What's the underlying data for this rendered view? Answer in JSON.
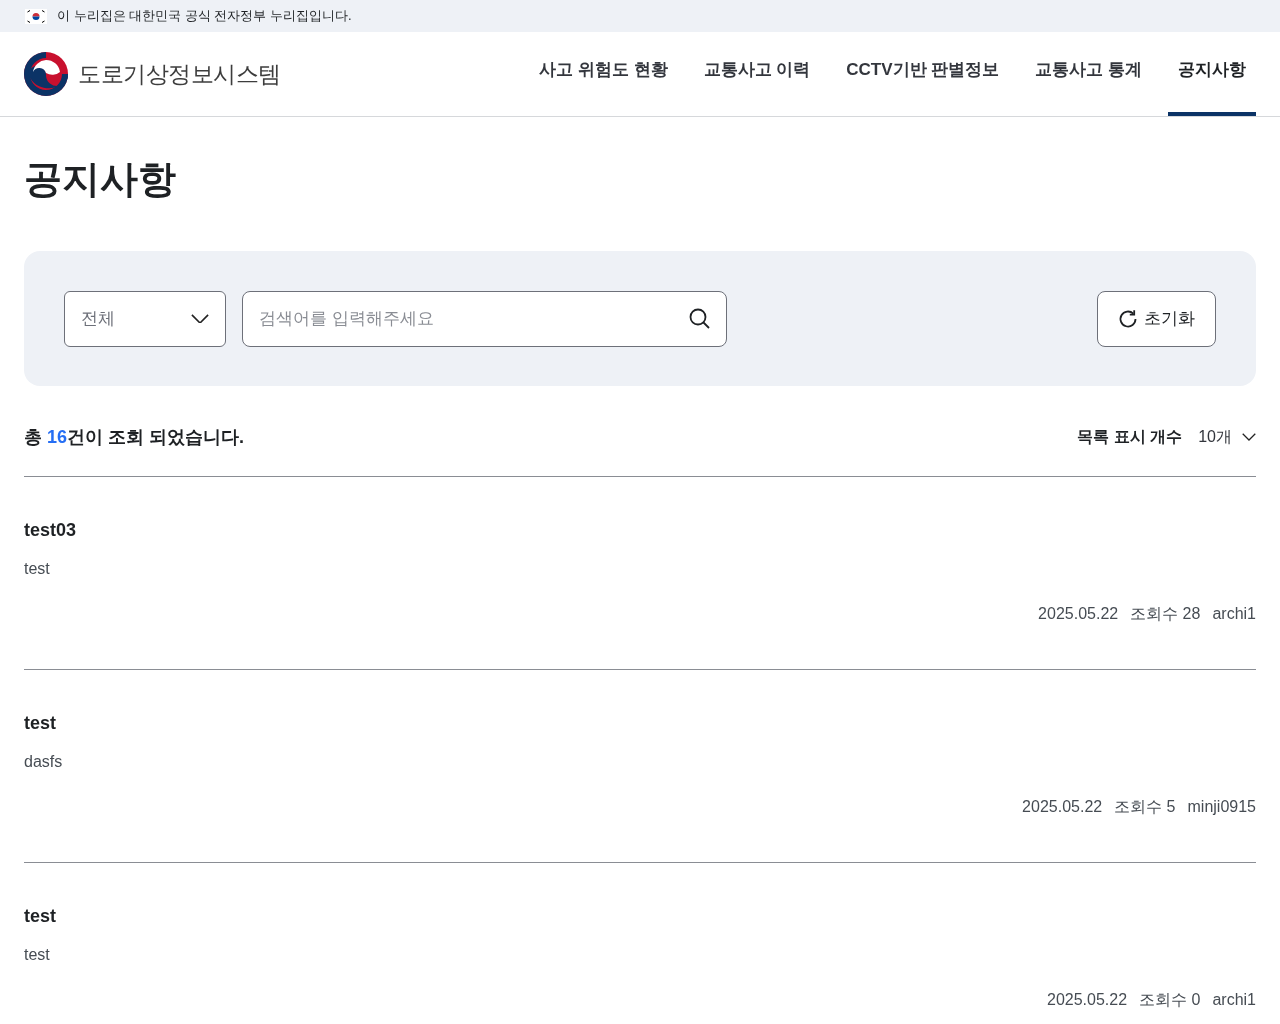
{
  "gov_banner": {
    "text": "이 누리집은 대한민국 공식 전자정부 누리집입니다."
  },
  "header": {
    "site_title": "도로기상정보시스템",
    "nav": [
      {
        "label": "사고 위험도 현황",
        "selected": false
      },
      {
        "label": "교통사고 이력",
        "selected": false
      },
      {
        "label": "CCTV기반 판별정보",
        "selected": false
      },
      {
        "label": "교통사고 통계",
        "selected": false
      },
      {
        "label": "공지사항",
        "selected": true
      }
    ]
  },
  "page_title": "공지사항",
  "search": {
    "category": "전체",
    "placeholder": "검색어를 입력해주세요",
    "reset_button": "초기화"
  },
  "result_summary": {
    "prefix": "총 ",
    "count": "16",
    "suffix": "건이 조회 되었습니다."
  },
  "page_size": {
    "label": "목록 표시 개수",
    "value": "10개"
  },
  "notices": [
    {
      "title": "test03",
      "body": "test",
      "date": "2025.05.22",
      "views": "조회수 28",
      "author": "archi1"
    },
    {
      "title": "test",
      "body": "dasfs",
      "date": "2025.05.22",
      "views": "조회수 5",
      "author": "minji0915"
    },
    {
      "title": "test",
      "body": "test",
      "date": "2025.05.22",
      "views": "조회수 0",
      "author": "archi1"
    }
  ]
}
